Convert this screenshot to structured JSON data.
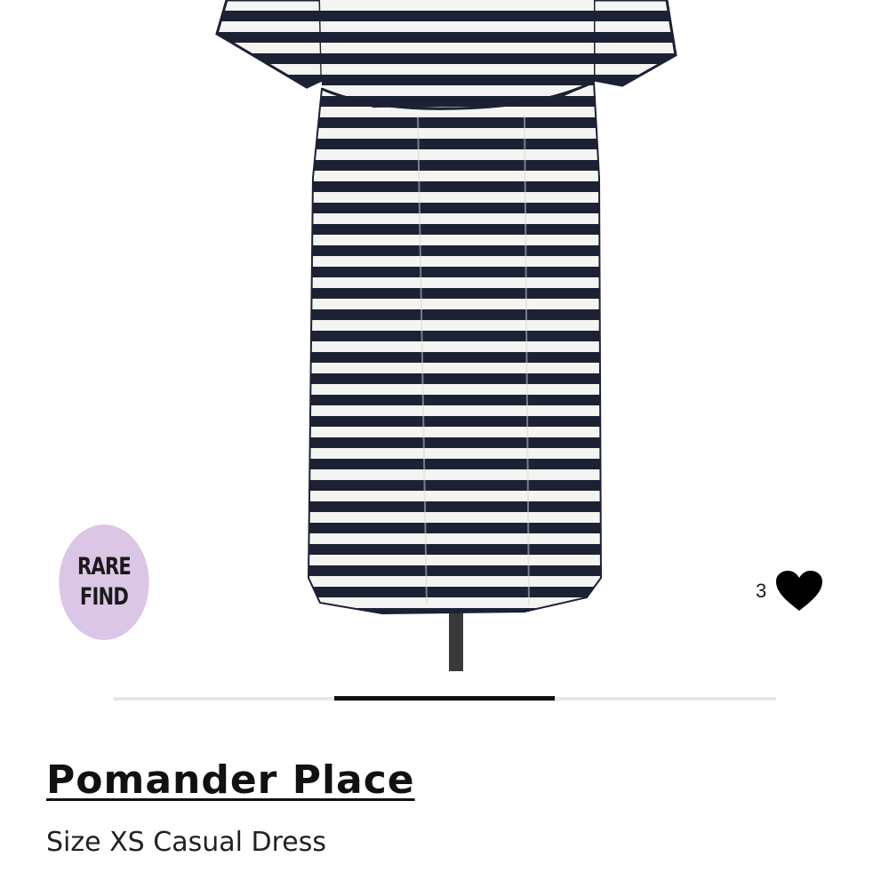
{
  "badge": {
    "line1": "RARE",
    "line2": "FIND",
    "color": "#dcc6e6"
  },
  "likes": {
    "count": "3",
    "icon": "heart-icon"
  },
  "carousel": {
    "total_slides": 3,
    "active_slide": 2
  },
  "product": {
    "brand": "Pomander Place",
    "subtitle": "Size XS Casual Dress"
  },
  "image": {
    "description_icon": "striped-dress-photo",
    "stripe_dark": "#1c2133",
    "stripe_light": "#f4f4f2"
  }
}
